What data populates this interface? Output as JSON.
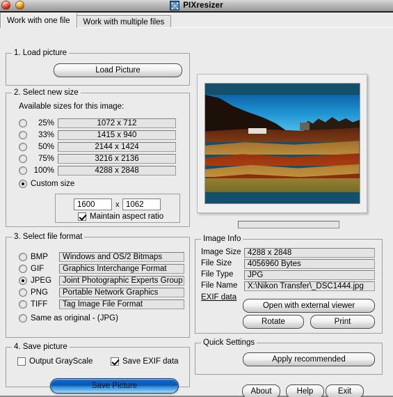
{
  "window": {
    "title": "PIXresizer",
    "icon": "resize-arrows-icon",
    "close_label": "",
    "minimize_label": ""
  },
  "tabs": [
    {
      "label": "Work with one file",
      "active": true
    },
    {
      "label": "Work with multiple files",
      "active": false
    }
  ],
  "section1": {
    "legend": "1. Load picture",
    "load_button": "Load Picture"
  },
  "section2": {
    "legend": "2. Select new size",
    "subtitle": "Available sizes for this image:",
    "sizes": [
      {
        "percent": "25%",
        "dimensions": "1072 x 712",
        "selected": false
      },
      {
        "percent": "33%",
        "dimensions": "1415 x 940",
        "selected": false
      },
      {
        "percent": "50%",
        "dimensions": "2144 x 1424",
        "selected": false
      },
      {
        "percent": "75%",
        "dimensions": "3216 x 2136",
        "selected": false
      },
      {
        "percent": "100%",
        "dimensions": "4288 x 2848",
        "selected": false
      }
    ],
    "custom_size_label": "Custom size",
    "custom_size_selected": true,
    "custom_width": "1600",
    "custom_separator": "x",
    "custom_height": "1062",
    "maintain_aspect_label": "Maintain aspect ratio",
    "maintain_aspect_checked": true
  },
  "section3": {
    "legend": "3. Select file format",
    "formats": [
      {
        "name": "BMP",
        "description": "Windows and OS/2 Bitmaps",
        "selected": false
      },
      {
        "name": "GIF",
        "description": "Graphics Interchange Format",
        "selected": false
      },
      {
        "name": "JPEG",
        "description": "Joint Photographic Experts Group",
        "selected": true
      },
      {
        "name": "PNG",
        "description": "Portable Network Graphics",
        "selected": false
      },
      {
        "name": "TIFF",
        "description": "Tag Image File Format",
        "selected": false
      }
    ],
    "same_as_original_label": "Same as original  - (JPG)",
    "same_as_original_selected": false
  },
  "section4": {
    "legend": "4. Save picture",
    "grayscale_label": "Output GrayScale",
    "grayscale_checked": false,
    "exif_label": "Save EXIF data",
    "exif_checked": true,
    "save_button": "Save Picture"
  },
  "image_info": {
    "legend": "Image Info",
    "rows": [
      {
        "label": "Image Size",
        "value": "4288 x 2848"
      },
      {
        "label": "File Size",
        "value": "4056960 Bytes"
      },
      {
        "label": "File Type",
        "value": "JPG"
      },
      {
        "label": "File Name",
        "value": "X:\\Nikon Transfer\\_DSC1444.jpg"
      }
    ],
    "exif_link": "EXIF data",
    "open_external_button": "Open with external viewer",
    "rotate_button": "Rotate",
    "print_button": "Print"
  },
  "quick_settings": {
    "legend": "Quick Settings",
    "apply_button": "Apply recommended"
  },
  "footer": {
    "about_button": "About",
    "help_button": "Help",
    "exit_button": "Exit"
  },
  "colors": {
    "window_face": "#ebebeb",
    "titlebar_top": "#d8d8d8",
    "titlebar_bottom": "#9a9a9a",
    "accent_blue": "#0b57b4",
    "close_red": "#f4553a",
    "minimize_orange": "#ffae1f",
    "icon_blue": "#1b5faa"
  }
}
